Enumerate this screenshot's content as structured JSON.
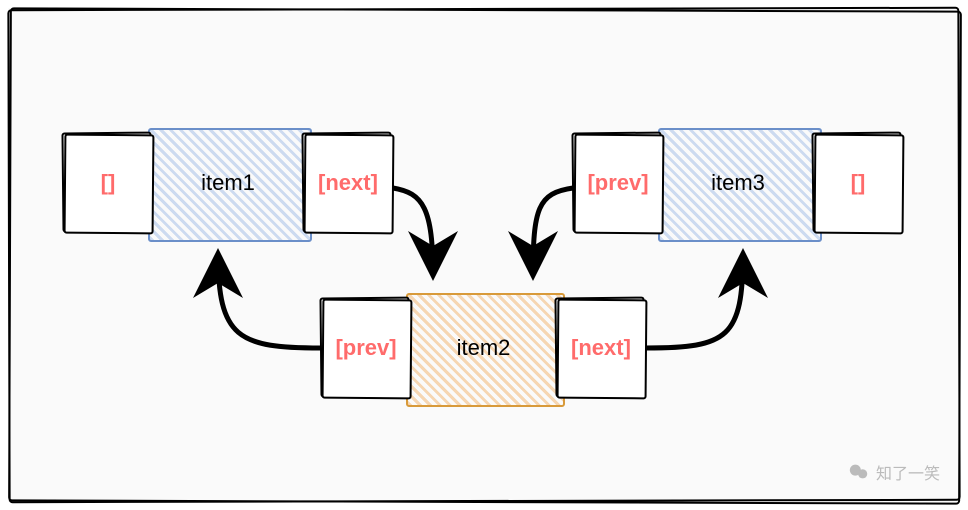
{
  "diagram": {
    "type": "doubly-linked-list",
    "nodes": [
      {
        "prev": "[]",
        "data": "item1",
        "next": "[next]"
      },
      {
        "prev": "[prev]",
        "data": "item2",
        "next": "[next]"
      },
      {
        "prev": "[prev]",
        "data": "item3",
        "next": "[]"
      }
    ],
    "arrows": [
      {
        "from": "item1.next",
        "to": "item2"
      },
      {
        "from": "item2.prev",
        "to": "item1"
      },
      {
        "from": "item2.next",
        "to": "item3"
      },
      {
        "from": "item3.prev",
        "to": "item2"
      }
    ]
  },
  "watermark": {
    "icon": "wechat-icon",
    "text": "知了一笑"
  }
}
